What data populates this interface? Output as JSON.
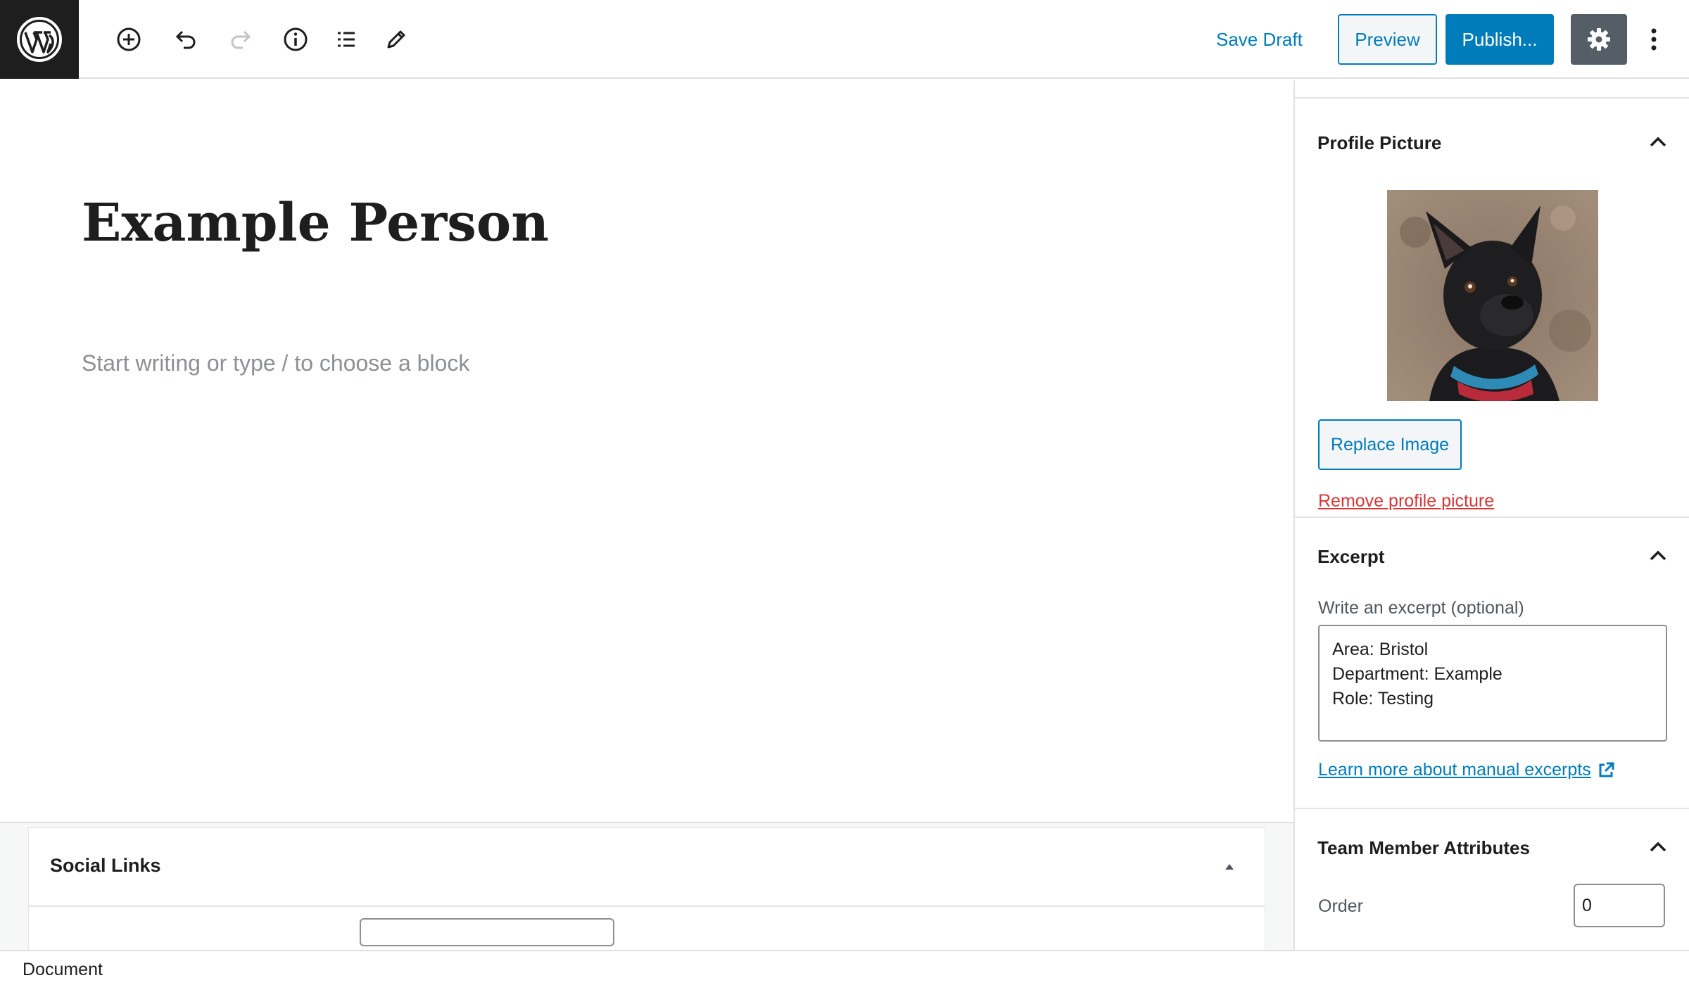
{
  "toolbar": {
    "save_draft": "Save Draft",
    "preview": "Preview",
    "publish": "Publish...",
    "icons": [
      "wordpress-logo",
      "add-block-icon",
      "undo-icon",
      "redo-icon",
      "info-icon",
      "list-view-icon",
      "edit-tools-icon",
      "gear-icon",
      "more-vertical-icon"
    ]
  },
  "editor": {
    "title": "Example Person",
    "placeholder": "Start writing or type / to choose a block"
  },
  "metabox": {
    "title": "Social Links"
  },
  "footer": {
    "breadcrumb": "Document"
  },
  "sidebar": {
    "profile_picture": {
      "title": "Profile Picture",
      "replace_label": "Replace Image",
      "remove_label": "Remove profile picture"
    },
    "excerpt": {
      "title": "Excerpt",
      "label": "Write an excerpt (optional)",
      "value": "Area: Bristol\nDepartment: Example\nRole: Testing",
      "learn_more": "Learn more about manual excerpts"
    },
    "team_member": {
      "title": "Team Member Attributes",
      "order_label": "Order",
      "order_value": "0"
    }
  },
  "colors": {
    "accent": "#007cba",
    "danger": "#d63638",
    "dark": "#1e1e1e",
    "settings_bg": "#555d66"
  }
}
